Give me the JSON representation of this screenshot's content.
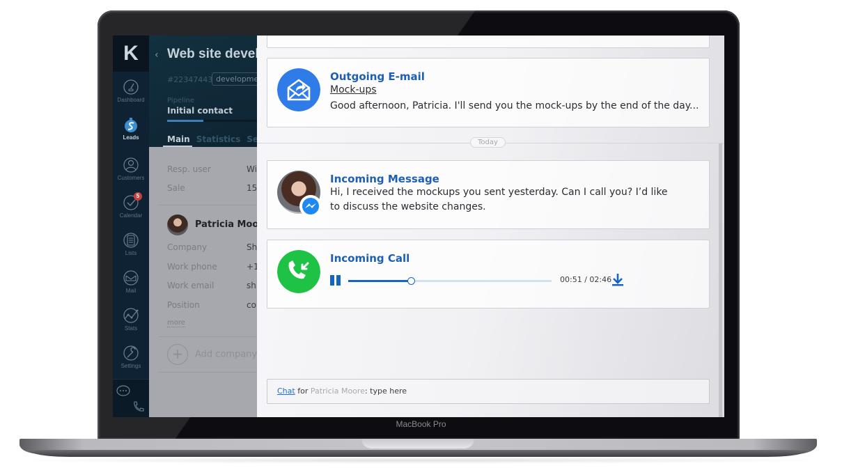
{
  "device": {
    "label": "MacBook Pro"
  },
  "nav": {
    "logo": "K",
    "items": [
      {
        "label": "Dashboard",
        "icon": "dashboard-icon"
      },
      {
        "label": "Leads",
        "icon": "leads-icon",
        "active": true
      },
      {
        "label": "Customers",
        "icon": "customers-icon"
      },
      {
        "label": "Calendar",
        "icon": "calendar-icon",
        "badge": "5"
      },
      {
        "label": "Lists",
        "icon": "lists-icon"
      },
      {
        "label": "Mail",
        "icon": "mail-icon"
      },
      {
        "label": "Stats",
        "icon": "stats-icon"
      },
      {
        "label": "Settings",
        "icon": "settings-icon"
      }
    ],
    "bottom_icons": [
      "chat-bubble-icon",
      "phone-icon"
    ]
  },
  "lead": {
    "back": "‹",
    "title": "Web site development",
    "id": "#22347443",
    "tag": "development",
    "pipeline_label": "Pipeline",
    "pipeline_stage": "Initial contact",
    "pipeline_progress": 0.4,
    "tabs": [
      "Main",
      "Statistics",
      "Setup"
    ],
    "active_tab": "Main",
    "fields": [
      {
        "label": "Resp. user",
        "value": "Wi"
      },
      {
        "label": "Sale",
        "value": "15"
      }
    ],
    "contact": {
      "name": "Patricia Moore",
      "fields": [
        {
          "label": "Company",
          "value": "Sh"
        },
        {
          "label": "Work phone",
          "value": "+1"
        },
        {
          "label": "Work email",
          "value": "sh"
        },
        {
          "label": "Position",
          "value": "co"
        }
      ],
      "more": "more"
    },
    "add_company": "Add company"
  },
  "feed": {
    "items": [
      {
        "type": "outgoing-email",
        "title": "Outgoing E-mail",
        "subject": "Mock-ups",
        "text": "Good afternoon, Patricia. I'll send you the mock-ups by the end of the day...",
        "icon_color": "#2f7be8"
      },
      {
        "type": "incoming-message",
        "title": "Incoming Message",
        "text": "Hi, I received the mockups you sent yesterday. Can I call you? I’d like to discuss the website changes.",
        "channel_icon": "messenger-icon",
        "channel_color": "#1e88f5"
      },
      {
        "type": "incoming-call",
        "title": "Incoming Call",
        "elapsed": "00:51",
        "duration": "02:46",
        "time_display": "00:51 / 02:46",
        "progress": 0.307,
        "icon_color": "#1ec244"
      }
    ],
    "day_separator": "Today",
    "composer": {
      "channel": "Chat",
      "for": "for",
      "recipient": "Patricia Moore",
      "placeholder": ": type here"
    }
  },
  "colors": {
    "accent": "#1e5fb3",
    "nav_bg": "#0f2233",
    "call_green": "#1ec244",
    "email_blue": "#2f7be8"
  }
}
